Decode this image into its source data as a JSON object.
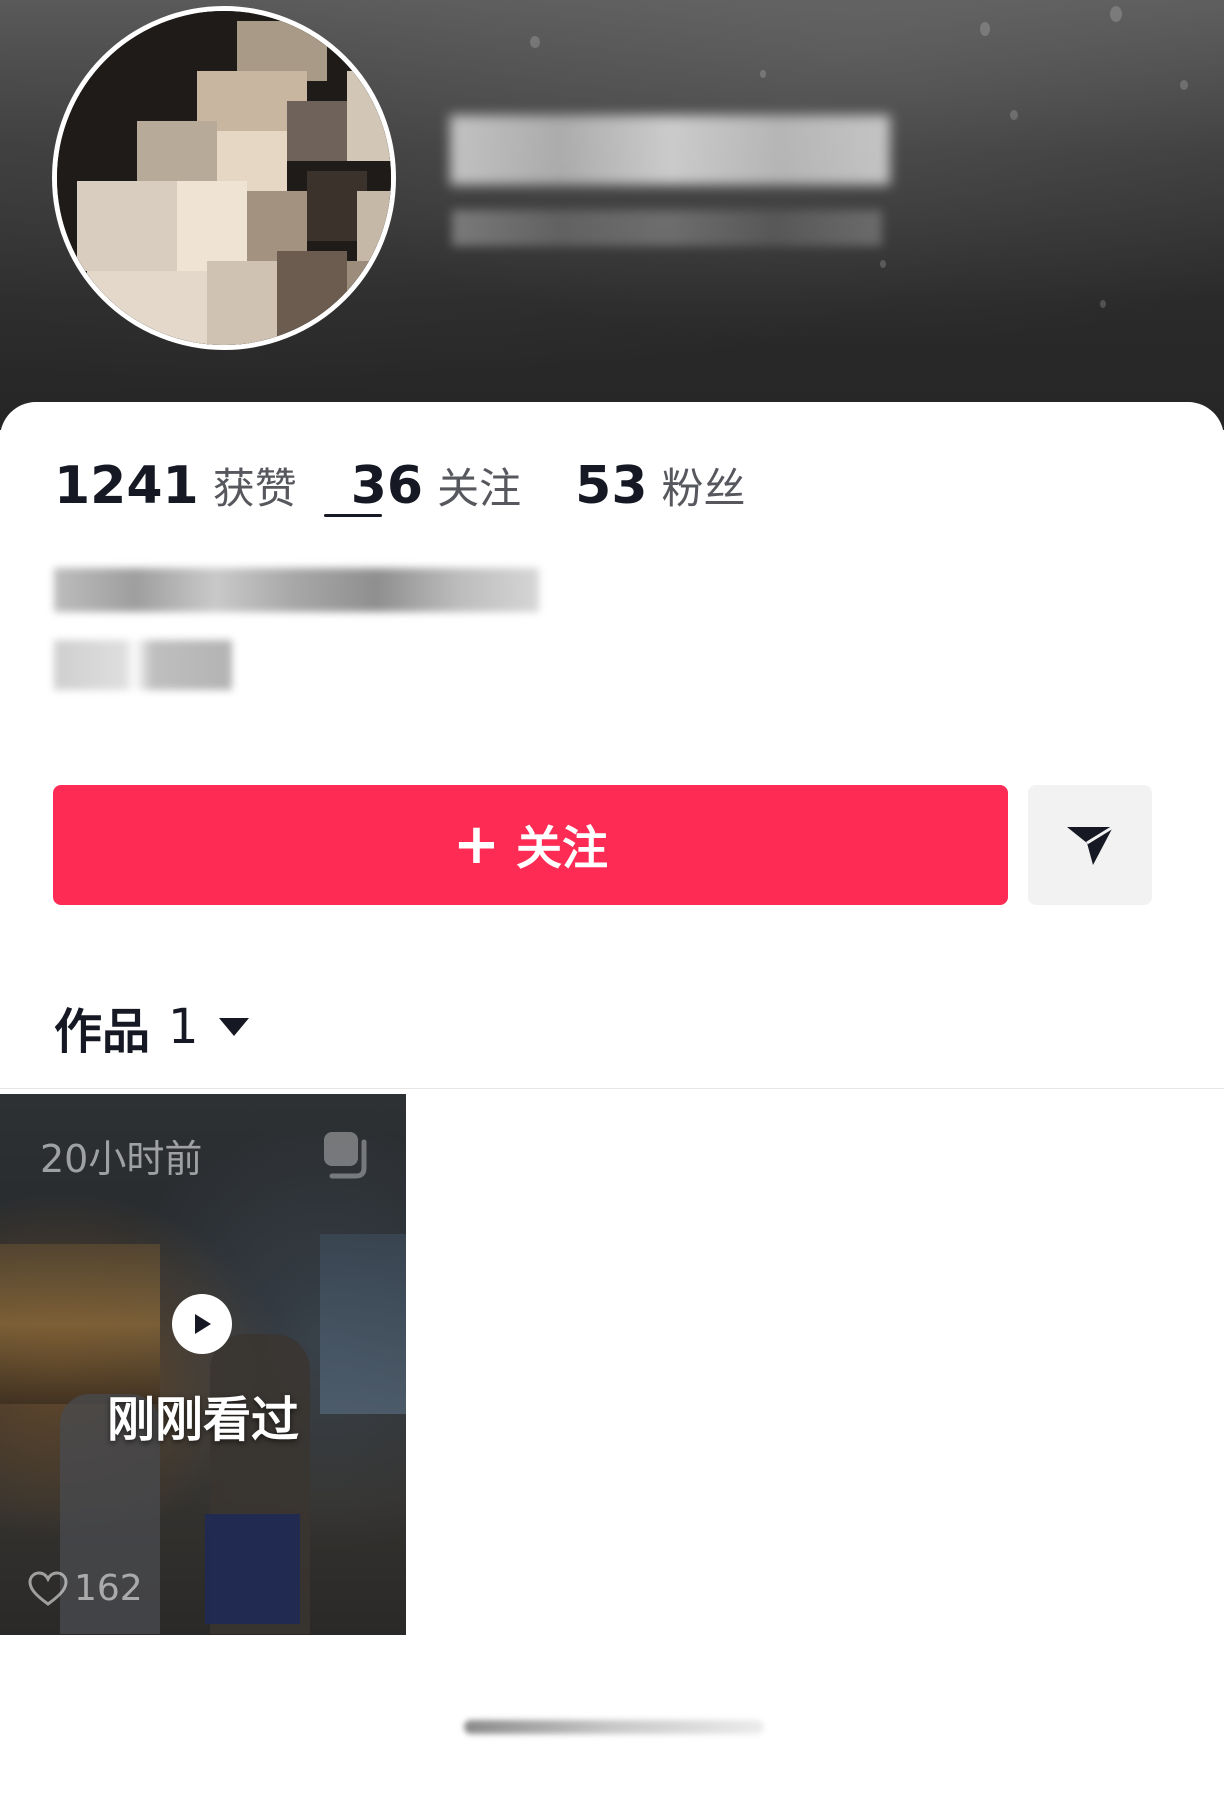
{
  "profile": {
    "stats": [
      {
        "value": "1241",
        "label": "获赞"
      },
      {
        "value": "36",
        "label": "关注"
      },
      {
        "value": "53",
        "label": "粉丝"
      }
    ]
  },
  "actions": {
    "follow_label": "关注",
    "follow_color": "#fe2c55"
  },
  "works_tab": {
    "label": "作品",
    "count": "1"
  },
  "videos": [
    {
      "time": "20小时前",
      "badge": "刚刚看过",
      "likes": "162"
    }
  ],
  "icons": [
    "send-icon",
    "plus-icon",
    "chevron-down-icon",
    "multi-image-icon",
    "play-icon",
    "heart-icon"
  ]
}
